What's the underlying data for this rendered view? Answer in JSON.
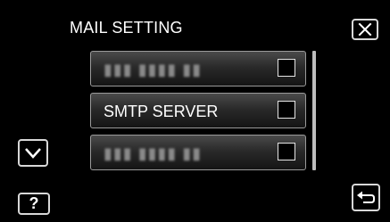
{
  "header": {
    "title": "MAIL SETTING"
  },
  "menu": {
    "items": [
      {
        "label": "▮▮▮ ▮▮▮▮ ▮▮",
        "state": "obscured",
        "checked": false
      },
      {
        "label": "SMTP SERVER",
        "state": "visible",
        "checked": false
      },
      {
        "label": "▮▮▮ ▮▮▮▮ ▮▮",
        "state": "obscured",
        "checked": false
      }
    ]
  },
  "buttons": {
    "close": "close-icon",
    "scroll_down": "chevron-down-icon",
    "help_label": "?",
    "back": "return-arrow-icon"
  },
  "colors": {
    "background": "#000000",
    "text": "#ffffff",
    "border": "#d8d8d8"
  }
}
